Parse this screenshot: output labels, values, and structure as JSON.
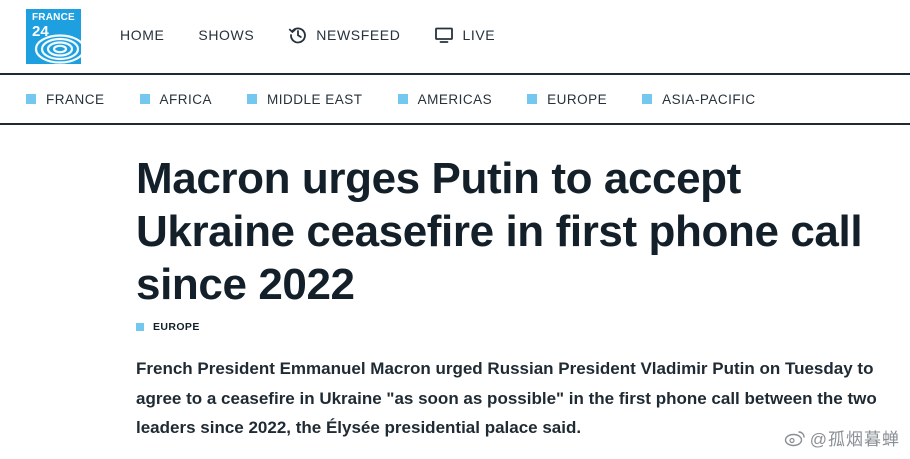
{
  "logo": {
    "brand": "FRANCE",
    "number": "24"
  },
  "main_nav": {
    "items": [
      {
        "label": "HOME"
      },
      {
        "label": "SHOWS"
      },
      {
        "label": "NEWSFEED",
        "icon": "history-clock-icon"
      },
      {
        "label": "LIVE",
        "icon": "monitor-icon"
      }
    ]
  },
  "section_nav": {
    "accent": "#74c7ee",
    "items": [
      {
        "label": "FRANCE"
      },
      {
        "label": "AFRICA"
      },
      {
        "label": "MIDDLE EAST"
      },
      {
        "label": "AMERICAS"
      },
      {
        "label": "EUROPE"
      },
      {
        "label": "ASIA-PACIFIC"
      }
    ]
  },
  "article": {
    "headline": "Macron urges Putin to accept Ukraine ceasefire in first phone call since 2022",
    "category": "EUROPE",
    "lead": "French President Emmanuel Macron urged Russian President Vladimir Putin on Tuesday to agree to a ceasefire in Ukraine \"as soon as possible\" in the first phone call between the two leaders since 2022, the Élysée presidential palace said."
  },
  "watermark": {
    "text": "@孤烟暮蝉",
    "icon": "weibo-icon"
  },
  "colors": {
    "brand_blue": "#1ea0e0",
    "text_dark": "#13202a"
  }
}
